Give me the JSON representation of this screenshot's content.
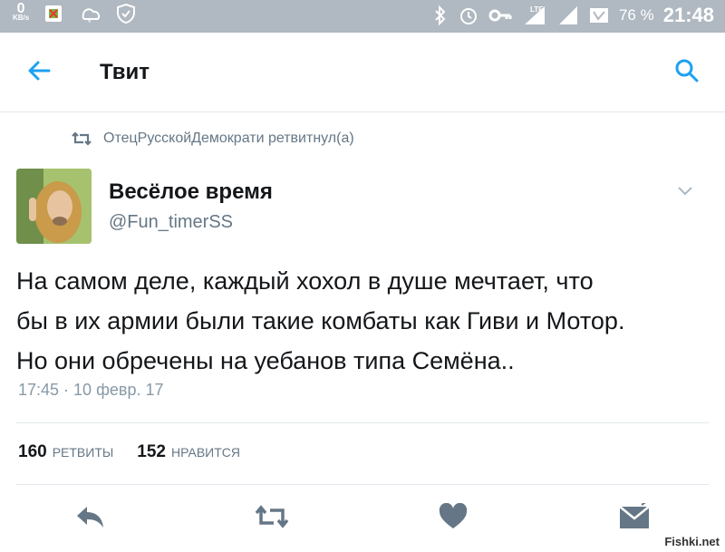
{
  "status_bar": {
    "speed_value": "0",
    "speed_unit": "KB/s",
    "network_type": "LTE",
    "battery_percent": "76 %",
    "time": "21:48",
    "icons": [
      "download-icon",
      "weather-icon",
      "vpn-shield-icon",
      "bluetooth-icon",
      "alarm-icon",
      "key-icon",
      "signal-icon",
      "signal-icon",
      "battery-icon"
    ]
  },
  "app_bar": {
    "title": "Твит",
    "back_icon": "arrow-left-icon",
    "search_icon": "search-icon"
  },
  "tweet": {
    "retweeted_by": "ОтецРусскойДемократи ретвитнул(а)",
    "author_name": "Весёлое время",
    "author_handle": "@Fun_timerSS",
    "text_lines": [
      "На самом деле, каждый хохол в душе мечтает, что",
      "бы в их армии были такие комбаты как Гиви и Мотор.",
      "Но они обречены на уебанов типа Семёна.."
    ],
    "timestamp": "17:45 · 10 февр. 17",
    "retweets_count": "160",
    "retweets_label": "РЕТВИТЫ",
    "likes_count": "152",
    "likes_label": "НРАВИТСЯ"
  },
  "actions": [
    "reply-icon",
    "retweet-icon",
    "like-icon",
    "message-icon"
  ],
  "colors": {
    "status_bar_bg": "#b0b8c1",
    "accent": "#1da1f2",
    "icon_gray": "#657786"
  },
  "watermark": "Fishki.net"
}
